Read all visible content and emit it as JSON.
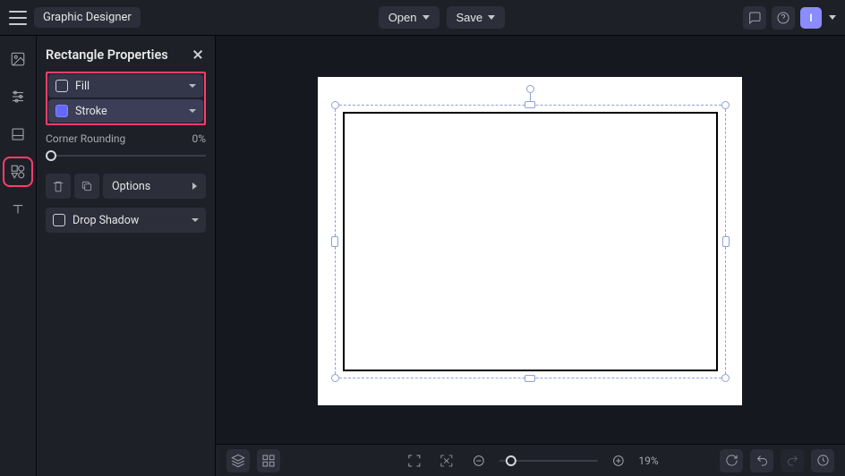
{
  "app_title": "Graphic Designer",
  "topbar": {
    "open_label": "Open",
    "save_label": "Save",
    "avatar_initial": "I"
  },
  "side_rail": {
    "items": [
      {
        "name": "image-tool",
        "active": false
      },
      {
        "name": "adjustments-tool",
        "active": false
      },
      {
        "name": "document-tool",
        "active": false
      },
      {
        "name": "shapes-tool",
        "active": true
      },
      {
        "name": "text-tool",
        "active": false
      }
    ]
  },
  "panel": {
    "title": "Rectangle Properties",
    "fill": {
      "label": "Fill",
      "enabled": false
    },
    "stroke": {
      "label": "Stroke",
      "enabled": true
    },
    "corner_rounding": {
      "label": "Corner Rounding",
      "value": 0,
      "display": "0%"
    },
    "options_label": "Options",
    "drop_shadow": {
      "label": "Drop Shadow",
      "enabled": false
    }
  },
  "document": {
    "selected_shape": "rectangle",
    "stroke_color": "#000000",
    "fill_color": null
  },
  "bottombar": {
    "zoom": {
      "value": 19,
      "display": "19%"
    }
  }
}
